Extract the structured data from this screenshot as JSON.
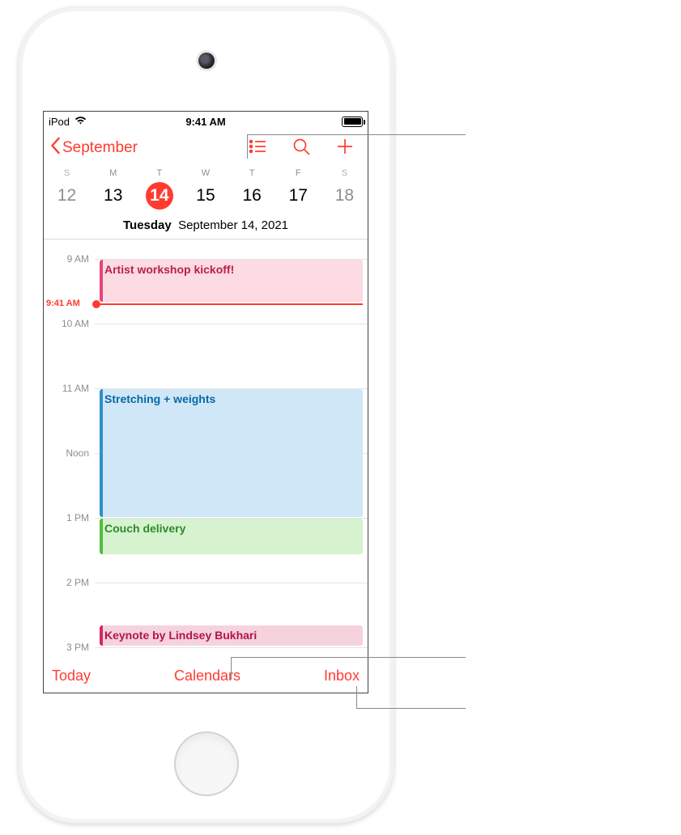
{
  "status_bar": {
    "carrier": "iPod",
    "time": "9:41 AM"
  },
  "nav": {
    "back_label": "September"
  },
  "week": {
    "day_abbrevs": [
      "S",
      "M",
      "T",
      "W",
      "T",
      "F",
      "S"
    ],
    "dates": [
      "12",
      "13",
      "14",
      "15",
      "16",
      "17",
      "18"
    ],
    "selected_index": 2
  },
  "full_date": {
    "weekday": "Tuesday",
    "date_string": "September 14, 2021"
  },
  "timeline": {
    "hours": [
      "9 AM",
      "10 AM",
      "11 AM",
      "Noon",
      "1 PM",
      "2 PM",
      "3 PM"
    ],
    "now_label": "9:41 AM",
    "events": [
      {
        "title": "Artist workshop kickoff!",
        "color": "pink"
      },
      {
        "title": "Stretching + weights",
        "color": "blue"
      },
      {
        "title": "Couch delivery",
        "color": "green"
      },
      {
        "title": "Keynote by Lindsey Bukhari",
        "color": "rose"
      }
    ]
  },
  "toolbar": {
    "today": "Today",
    "calendars": "Calendars",
    "inbox": "Inbox"
  }
}
